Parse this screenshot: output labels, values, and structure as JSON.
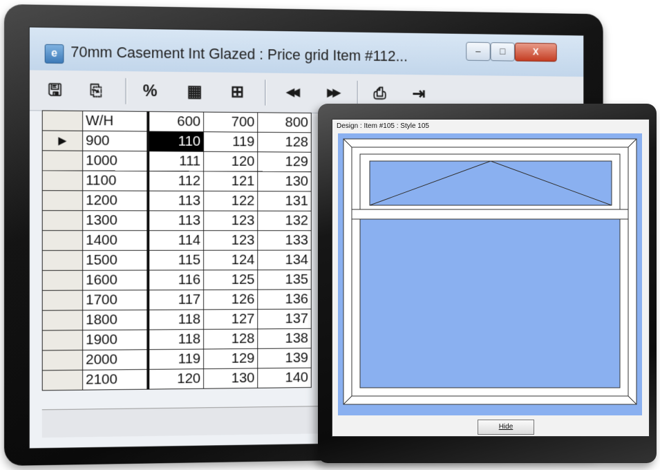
{
  "window": {
    "title": "70mm Casement Int Glazed : Price grid Item #112...",
    "min_glyph": "–",
    "max_glyph": "□",
    "close_glyph": "X"
  },
  "toolbar": {
    "save": "🖫",
    "copy": "⎘",
    "percent": "%",
    "grid": "▦",
    "layout": "⊞",
    "rewind": "◀◀",
    "forward": "▶▶",
    "print": "⎙",
    "exit": "⇥"
  },
  "grid": {
    "corner": "W/H",
    "columns": [
      "600",
      "700",
      "800"
    ],
    "rows": [
      {
        "h": "900",
        "v": [
          "110",
          "119",
          "128"
        ]
      },
      {
        "h": "1000",
        "v": [
          "111",
          "120",
          "129"
        ]
      },
      {
        "h": "1100",
        "v": [
          "112",
          "121",
          "130"
        ]
      },
      {
        "h": "1200",
        "v": [
          "113",
          "122",
          "131"
        ]
      },
      {
        "h": "1300",
        "v": [
          "113",
          "123",
          "132"
        ]
      },
      {
        "h": "1400",
        "v": [
          "114",
          "123",
          "133"
        ]
      },
      {
        "h": "1500",
        "v": [
          "115",
          "124",
          "134"
        ]
      },
      {
        "h": "1600",
        "v": [
          "116",
          "125",
          "135"
        ]
      },
      {
        "h": "1700",
        "v": [
          "117",
          "126",
          "136"
        ]
      },
      {
        "h": "1800",
        "v": [
          "118",
          "127",
          "137"
        ]
      },
      {
        "h": "1900",
        "v": [
          "118",
          "128",
          "138"
        ]
      },
      {
        "h": "2000",
        "v": [
          "119",
          "129",
          "139"
        ]
      },
      {
        "h": "2100",
        "v": [
          "120",
          "130",
          "140"
        ]
      }
    ],
    "current_row_marker": "▶"
  },
  "design": {
    "title": "Design : Item #105 : Style 105",
    "hide_label": "Hide",
    "glass_color": "#8ab0f0",
    "frame_color": "#ffffff"
  }
}
